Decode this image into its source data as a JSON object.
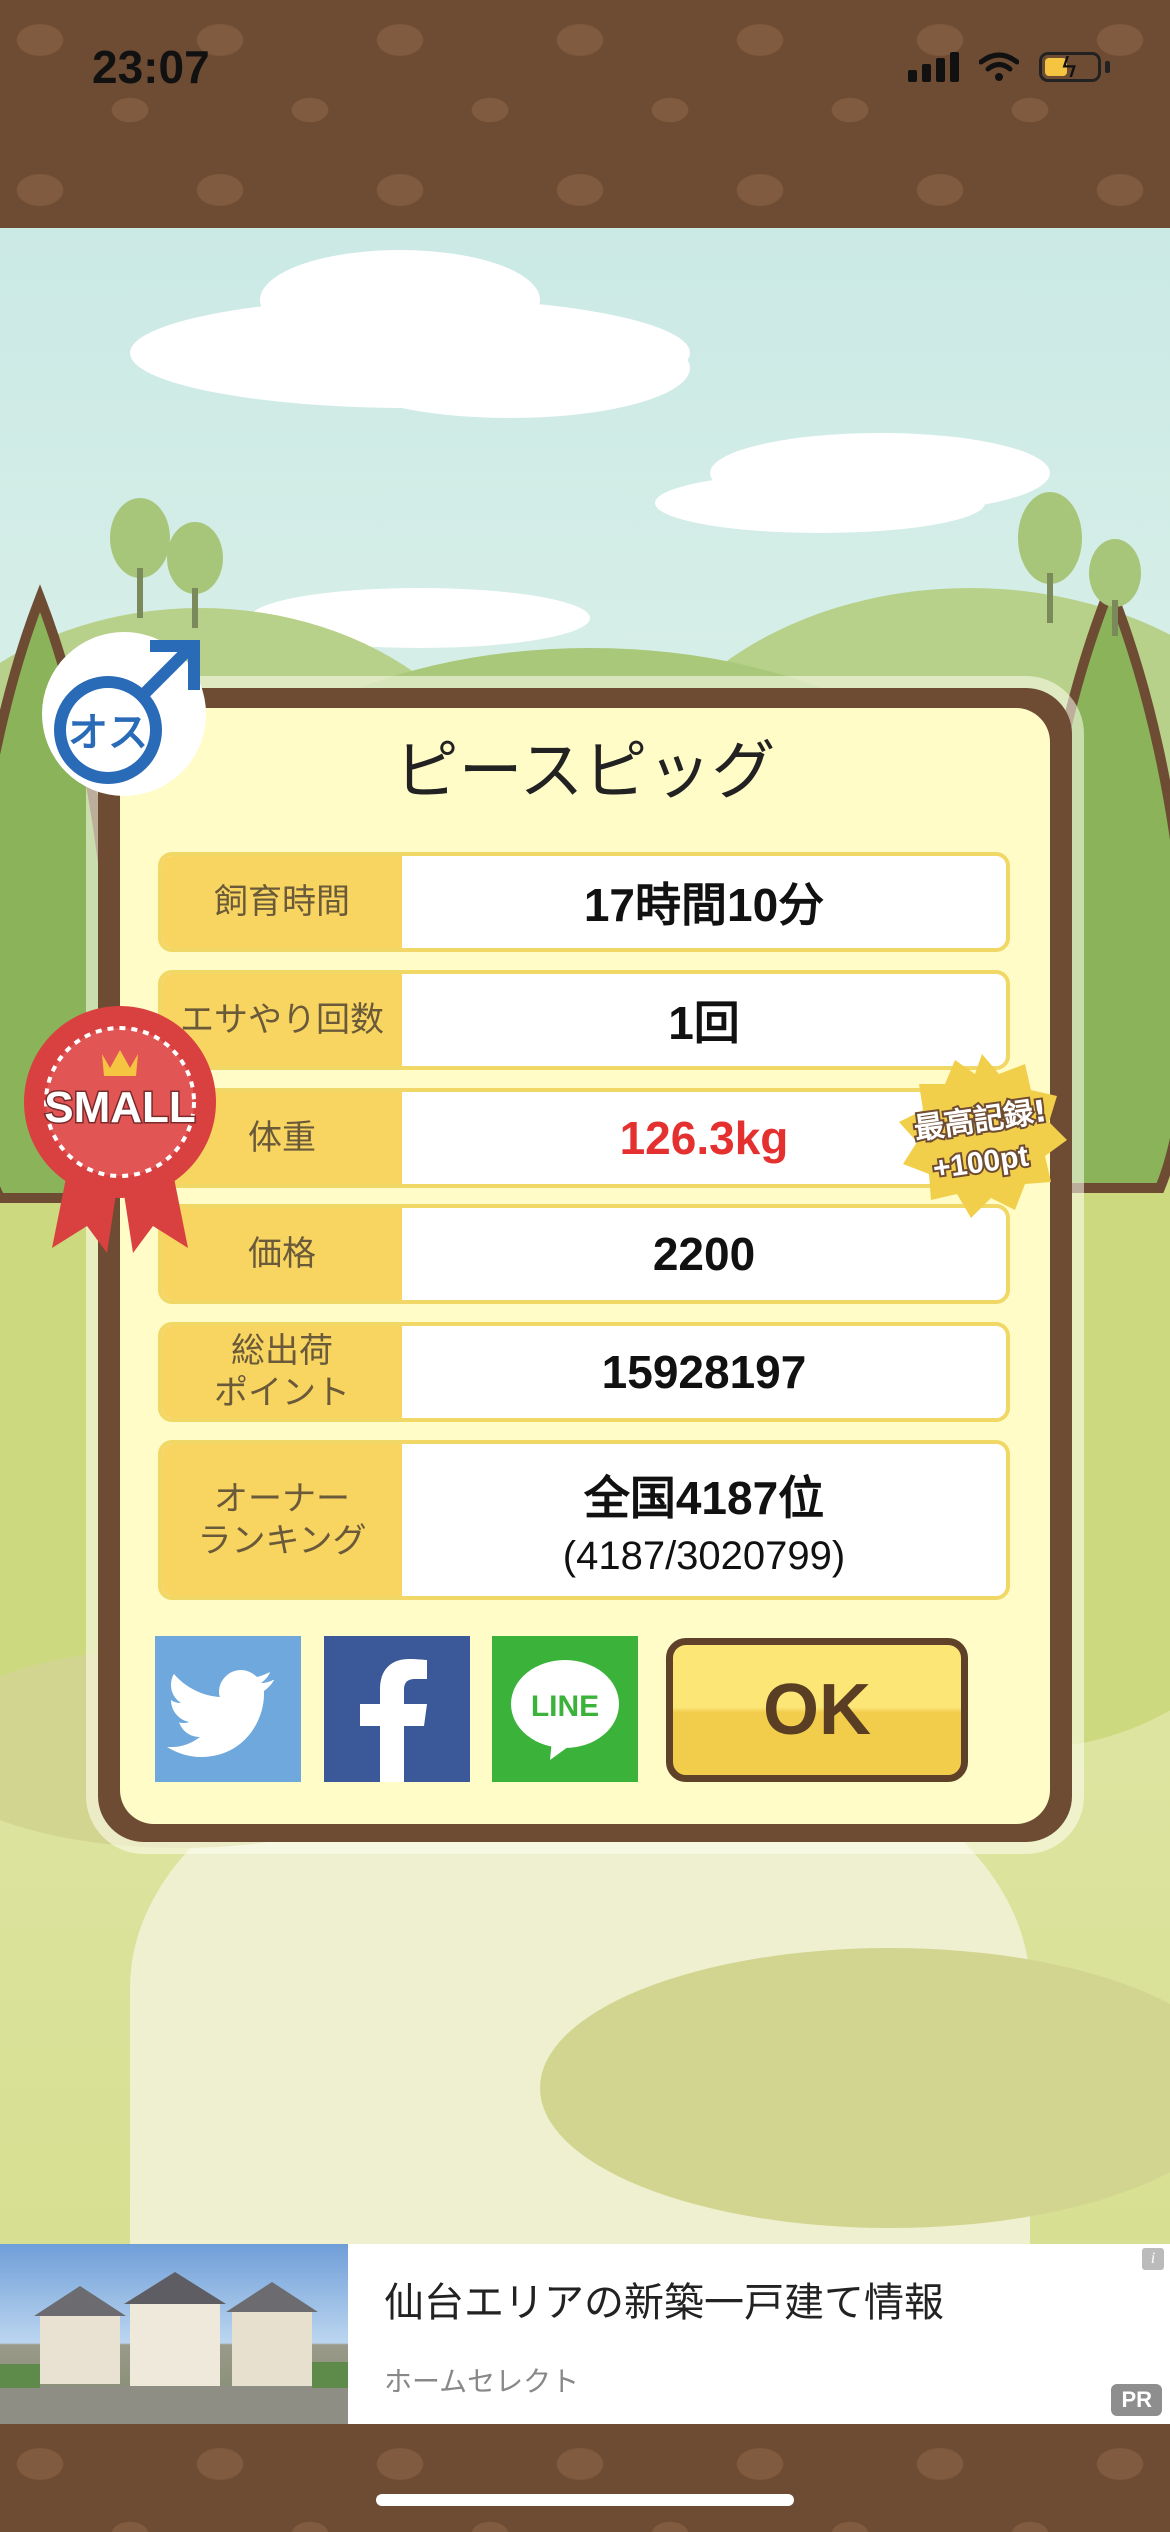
{
  "status_bar": {
    "time": "23:07",
    "battery_color": "#f5c542"
  },
  "dialog": {
    "title": "ピースピッグ",
    "rows": [
      {
        "label": "飼育時間",
        "value": "17時間10分"
      },
      {
        "label": "エサやり回数",
        "value": "1回"
      },
      {
        "label": "体重",
        "value": "126.3kg",
        "value_color": "#e53030"
      },
      {
        "label": "価格",
        "value": "2200"
      },
      {
        "label": "総出荷\nポイント",
        "value": "15928197"
      },
      {
        "label": "オーナー\nランキング",
        "value": "全国4187位",
        "sub_value": "(4187/3020799)"
      }
    ],
    "share_buttons": [
      {
        "name": "twitter",
        "icon": "twitter-bird-icon",
        "color": "#6fa8dc"
      },
      {
        "name": "facebook",
        "icon": "facebook-f-icon",
        "color": "#3b5998",
        "label": "f"
      },
      {
        "name": "line",
        "icon": "line-icon",
        "color": "#3bb33a",
        "label": "LINE"
      }
    ],
    "ok_label": "OK"
  },
  "badges": {
    "gender": {
      "label": "オス",
      "icon": "male-symbol-icon",
      "color": "#2a6bb8"
    },
    "size_ribbon": {
      "label": "SMALL",
      "color": "#d94040"
    },
    "record": {
      "line1": "最高記録!",
      "line2": "+100pt",
      "color": "#f1cf4a"
    }
  },
  "ad": {
    "title": "仙台エリアの新築一戸建て情報",
    "source": "ホームセレクト",
    "pr_label": "PR",
    "info_label": "i"
  }
}
